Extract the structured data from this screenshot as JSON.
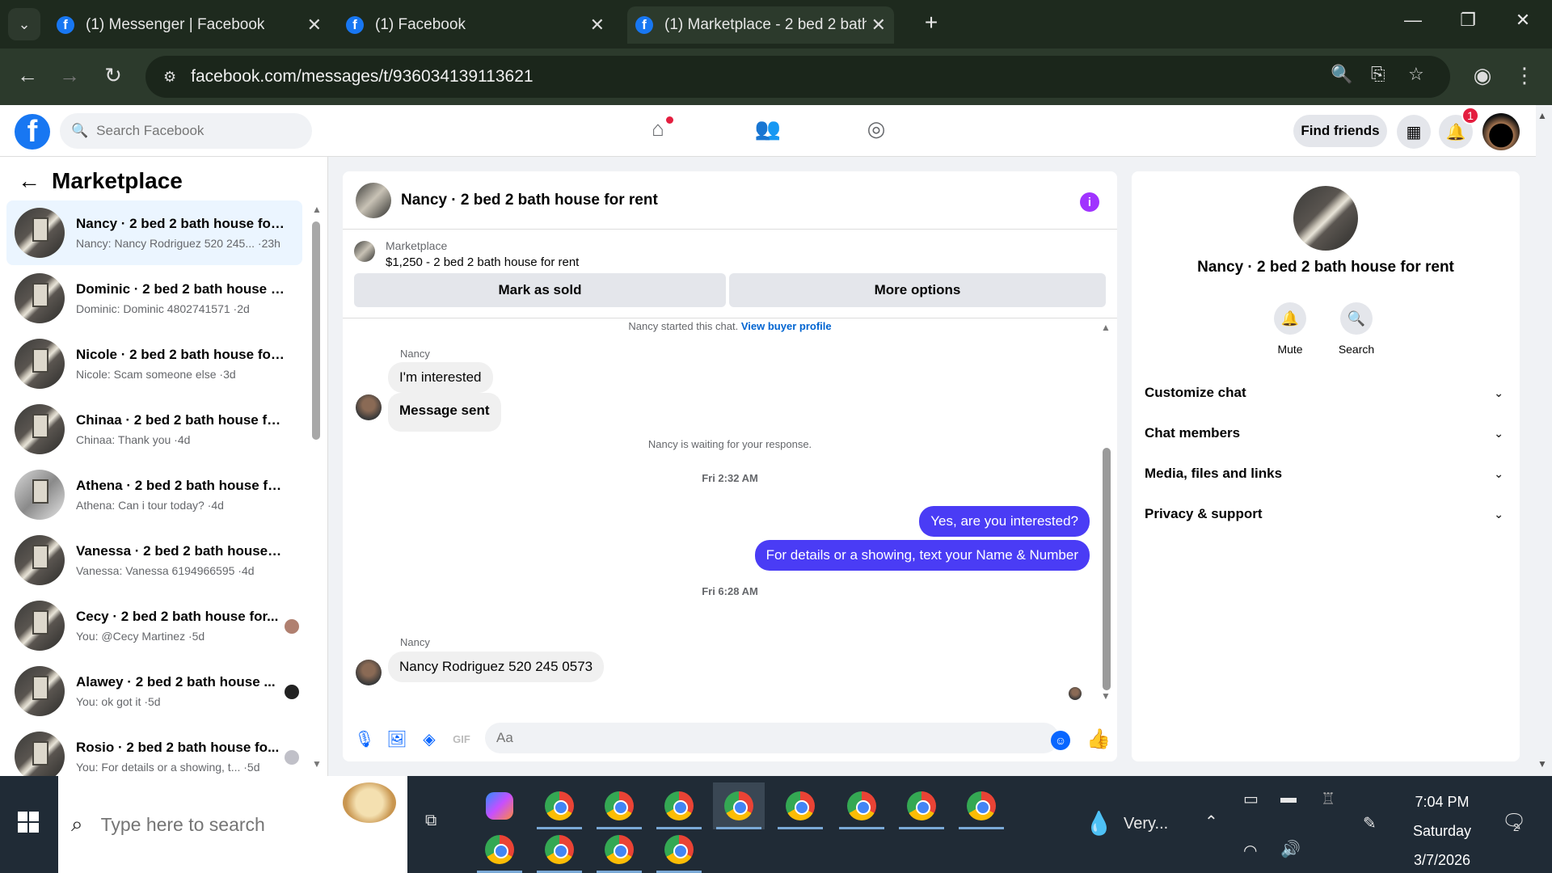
{
  "browser": {
    "tabs": [
      {
        "title": "(1) Messenger | Facebook"
      },
      {
        "title": "(1) Facebook"
      },
      {
        "title": "(1) Marketplace - 2 bed 2 bath h"
      }
    ],
    "url": "facebook.com/messages/t/936034139113621"
  },
  "fb": {
    "search_placeholder": "Search Facebook",
    "find_friends": "Find friends",
    "notif_count": "1"
  },
  "left": {
    "title": "Marketplace",
    "conversations": [
      {
        "name": "Nancy · 2 bed 2 bath house for ...",
        "snippet": "Nancy: Nancy Rodriguez 520 245... ·23h"
      },
      {
        "name": "Dominic · 2 bed 2 bath house f...",
        "snippet": "Dominic: Dominic 4802741571 ·2d"
      },
      {
        "name": "Nicole · 2 bed 2 bath house for ...",
        "snippet": "Nicole: Scam someone else ·3d"
      },
      {
        "name": "Chinaa · 2 bed 2 bath house for...",
        "snippet": "Chinaa: Thank you ·4d"
      },
      {
        "name": "Athena · 2 bed 2 bath house for...",
        "snippet": "Athena: Can i tour today? ·4d"
      },
      {
        "name": "Vanessa · 2 bed 2 bath house fo...",
        "snippet": "Vanessa: Vanessa 6194966595 ·4d"
      },
      {
        "name": "Cecy · 2 bed 2 bath house for...",
        "snippet": "You: @Cecy Martinez ·5d"
      },
      {
        "name": "Alawey · 2 bed 2 bath house ...",
        "snippet": "You: ok got it ·5d"
      },
      {
        "name": "Rosio · 2 bed 2 bath house fo...",
        "snippet": "You: For details or a showing, t... ·5d"
      }
    ]
  },
  "chat": {
    "title": "Nancy · 2 bed 2 bath house for rent",
    "listing_label": "Marketplace",
    "listing_price": "$1,250 - 2 bed 2 bath house for rent",
    "mark_sold": "Mark as sold",
    "more_options": "More options",
    "started": "Nancy started this chat.",
    "view_profile": "View buyer profile",
    "sender": "Nancy",
    "msg_interested": "I'm interested",
    "msg_sent": "Message sent",
    "waiting": "Nancy is waiting for your response.",
    "time1": "Fri 2:32 AM",
    "out1": "Yes, are you interested?",
    "out2": "For details or a showing, text your Name & Number",
    "time2": "Fri 6:28 AM",
    "msg_phone": "Nancy Rodriguez 520 245 0573",
    "input_placeholder": "Aa"
  },
  "right": {
    "name": "Nancy · 2 bed 2 bath house for rent",
    "mute": "Mute",
    "search": "Search",
    "sections": [
      "Customize chat",
      "Chat members",
      "Media, files and links",
      "Privacy & support"
    ]
  },
  "taskbar": {
    "search_placeholder": "Type here to search",
    "weather": "Very...",
    "time": "7:04 PM",
    "day": "Saturday",
    "date": "3/7/2026",
    "notif": "2"
  }
}
